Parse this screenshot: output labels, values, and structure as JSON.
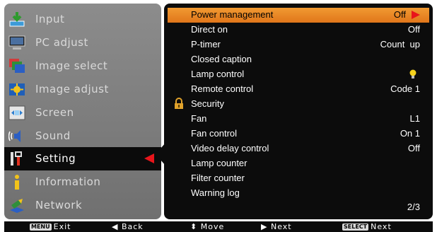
{
  "menu": {
    "items": [
      {
        "label": "Input",
        "icon": "input-icon"
      },
      {
        "label": "PC adjust",
        "icon": "pc-adjust-icon"
      },
      {
        "label": "Image select",
        "icon": "image-select-icon"
      },
      {
        "label": "Image adjust",
        "icon": "image-adjust-icon"
      },
      {
        "label": "Screen",
        "icon": "screen-icon"
      },
      {
        "label": "Sound",
        "icon": "sound-icon"
      },
      {
        "label": "Setting",
        "icon": "setting-icon",
        "active": true
      },
      {
        "label": "Information",
        "icon": "information-icon"
      },
      {
        "label": "Network",
        "icon": "network-icon"
      }
    ]
  },
  "settings": {
    "rows": [
      {
        "label": "Power management",
        "value": "Off"
      },
      {
        "label": "Direct on",
        "value": "Off"
      },
      {
        "label": "P-timer",
        "value": "Count  up"
      },
      {
        "label": "Closed caption",
        "value": ""
      },
      {
        "label": "Lamp control",
        "value": ""
      },
      {
        "label": "Remote control",
        "value": "Code 1"
      },
      {
        "label": "Security",
        "value": ""
      },
      {
        "label": "Fan",
        "value": "L1"
      },
      {
        "label": "Fan control",
        "value": "On 1"
      },
      {
        "label": "Video delay control",
        "value": "Off"
      },
      {
        "label": "Lamp counter",
        "value": ""
      },
      {
        "label": "Filter counter",
        "value": ""
      },
      {
        "label": "Warning log",
        "value": ""
      }
    ],
    "page": "2/3"
  },
  "footer": {
    "exit_key": "MENU",
    "exit_label": "Exit",
    "back_label": "Back",
    "move_label": "Move",
    "next_label": "Next",
    "select_key": "SELECT",
    "select_label": "Next"
  },
  "colors": {
    "highlight": "#e98626",
    "accent_arrow": "#e8151b",
    "panel_bg": "#0c0c0c",
    "menu_bg": "#7f7f7f"
  }
}
